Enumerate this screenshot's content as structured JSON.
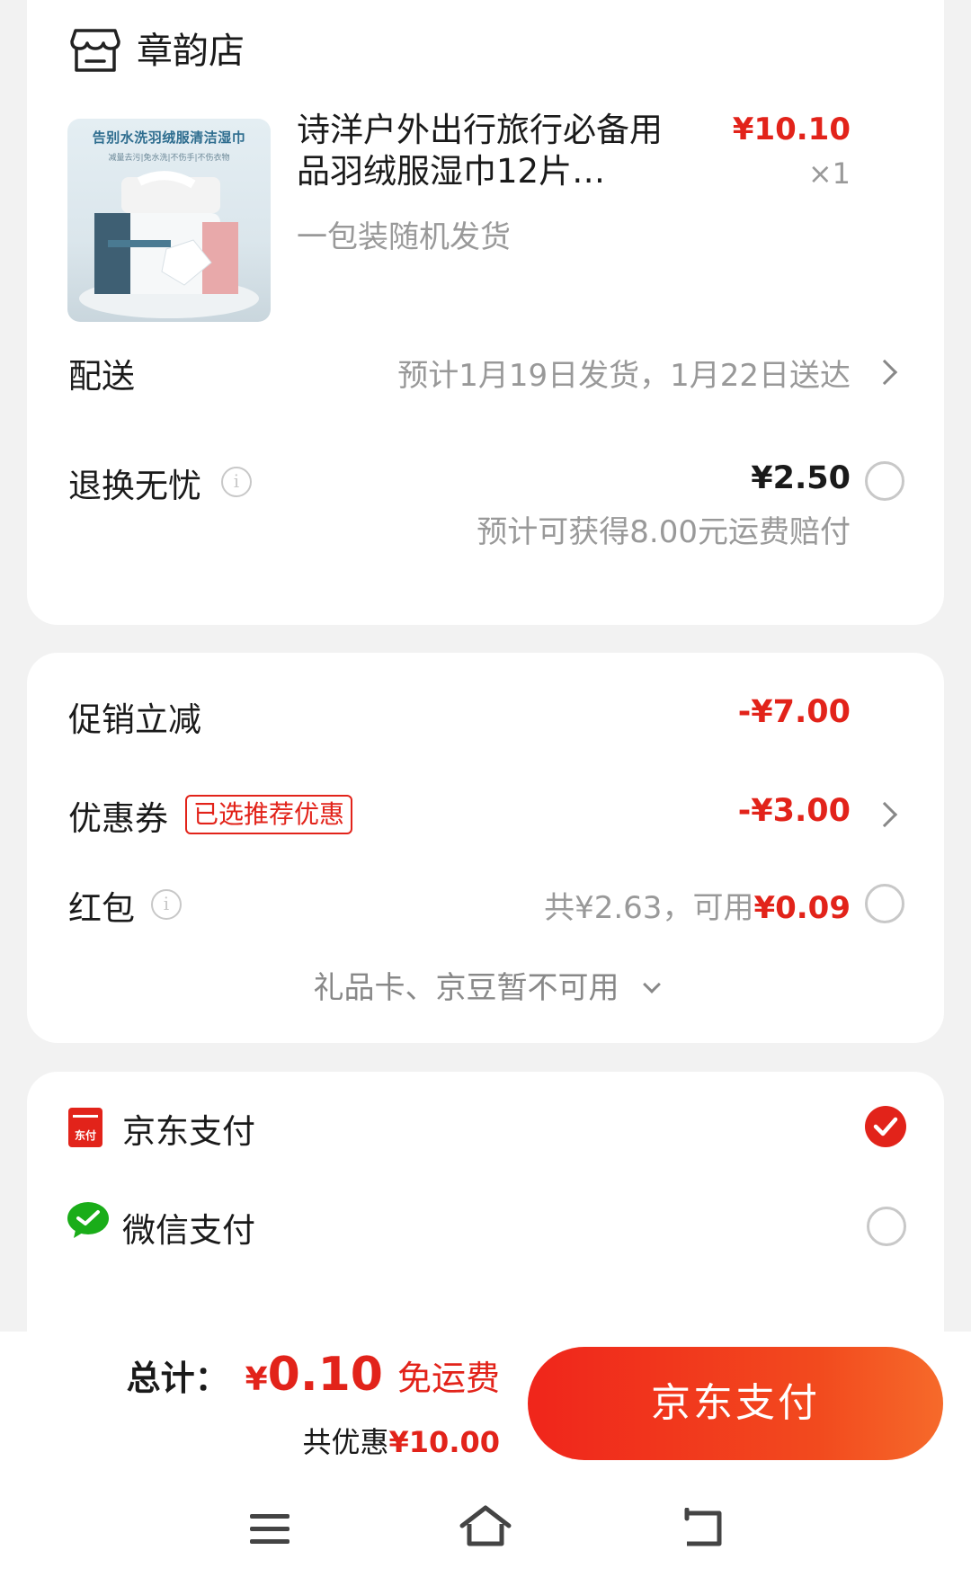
{
  "shop": {
    "name": "章韵店"
  },
  "product": {
    "image_banner": "告别水洗羽绒服清洁湿巾",
    "image_sub": "减量去污|免水洗|不伤手|不伤衣物",
    "title": "诗洋户外出行旅行必备用品羽绒服湿巾12片…",
    "spec": "一包装随机发货",
    "price": "¥10.10",
    "qty": "×1"
  },
  "delivery": {
    "label": "配送",
    "value": "预计1月19日发货，1月22日送达"
  },
  "return": {
    "label": "退换无忧",
    "price": "¥2.50",
    "note": "预计可获得8.00元运费赔付"
  },
  "promo": {
    "label": "促销立减",
    "value": "-¥7.00"
  },
  "coupon": {
    "label": "优惠券",
    "tag": "已选推荐优惠",
    "value": "-¥3.00"
  },
  "redpack": {
    "label": "红包",
    "total": "共¥2.63，可用",
    "usable": "¥0.09"
  },
  "giftcard": {
    "text": "礼品卡、京豆暂不可用"
  },
  "payments": [
    {
      "name": "京东支付",
      "icon_text": "东付",
      "selected": true
    },
    {
      "name": "微信支付",
      "selected": false
    }
  ],
  "summary": {
    "total_label": "总计：",
    "currency": "¥",
    "total": "0.10",
    "shipping": "免运费",
    "discount_label": "共优惠",
    "discount": "¥10.00"
  },
  "pay_button": "京东支付",
  "colors": {
    "accent": "#e2231a",
    "wechat": "#1aad19"
  }
}
